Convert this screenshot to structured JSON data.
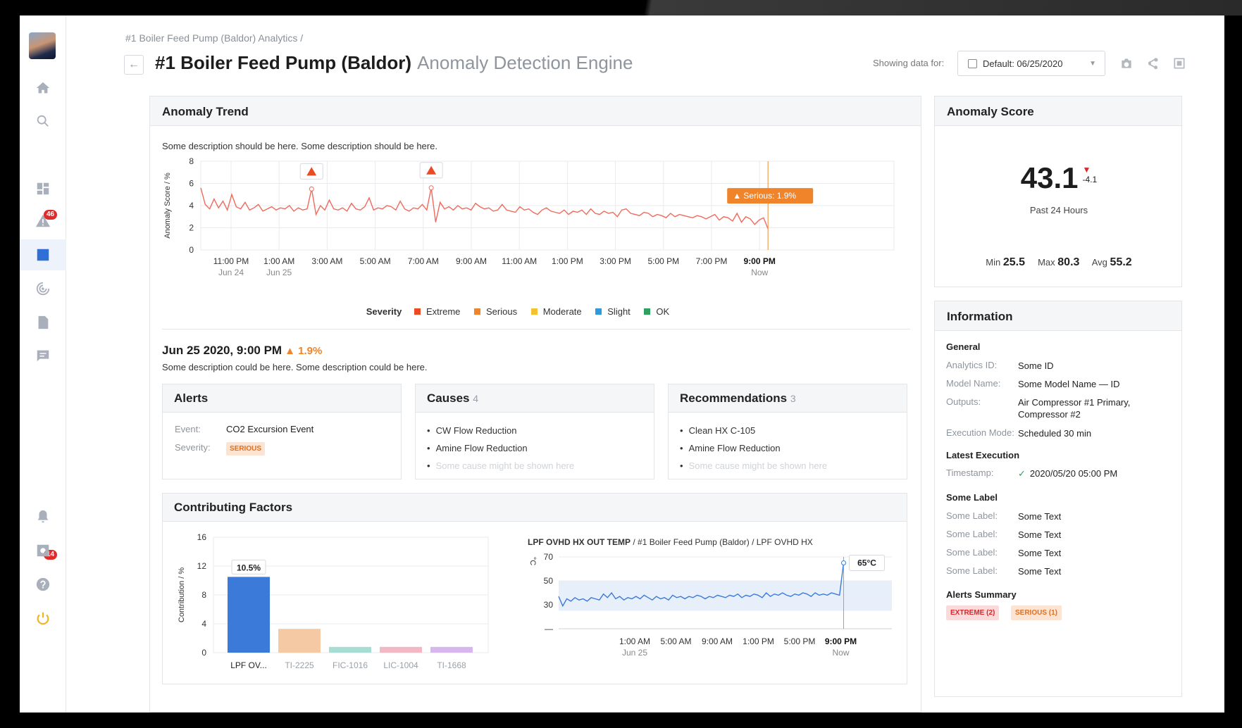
{
  "sidebar": {
    "notif_alerts": "46",
    "notif_bell": "14"
  },
  "breadcrumb": {
    "text": "#1 Boiler Feed Pump (Baldor) Analytics",
    "sep": "/"
  },
  "header": {
    "title": "#1 Boiler Feed Pump (Baldor)",
    "subtitle": "Anomaly Detection Engine",
    "showing_label": "Showing data for:",
    "date_value": "Default: 06/25/2020"
  },
  "trend": {
    "title": "Anomaly Trend",
    "description": "Some description should be here. Some description should be here.",
    "tooltip": "Serious: 1.9%",
    "severity_label": "Severity",
    "legend": [
      {
        "name": "Extreme",
        "color": "#ea4a24"
      },
      {
        "name": "Serious",
        "color": "#f0842b"
      },
      {
        "name": "Moderate",
        "color": "#f2c230"
      },
      {
        "name": "Slight",
        "color": "#2d9bdb"
      },
      {
        "name": "OK",
        "color": "#2fa060"
      }
    ]
  },
  "event": {
    "datetime": "Jun 25 2020, 9:00 PM",
    "pct": "1.9%",
    "description": "Some description could be here. Some description could be here."
  },
  "alerts": {
    "title": "Alerts",
    "event_label": "Event:",
    "event_value": "CO2 Excursion Event",
    "severity_label": "Severity:",
    "severity_value": "SERIOUS"
  },
  "causes": {
    "title": "Causes",
    "count": "4",
    "items": [
      "CW Flow Reduction",
      "Amine Flow Reduction",
      "Some cause might be shown here"
    ]
  },
  "recs": {
    "title": "Recommendations",
    "count": "3",
    "items": [
      "Clean HX C-105",
      "Amine Flow Reduction",
      "Some cause might be shown here"
    ]
  },
  "factors": {
    "title": "Contributing Factors",
    "callout": "10.5%",
    "line_title_bold": "LPF OVHD HX OUT TEMP",
    "line_title_rest": " / #1 Boiler Feed Pump (Baldor) / LPF OVHD HX",
    "line_callout": "65°C",
    "line_ylabel": "°C"
  },
  "score": {
    "title": "Anomaly Score",
    "value": "43.1",
    "delta": "-4.1",
    "period": "Past 24 Hours",
    "min_label": "Min",
    "min": "25.5",
    "max_label": "Max",
    "max": "80.3",
    "avg_label": "Avg",
    "avg": "55.2"
  },
  "info": {
    "title": "Information",
    "general": "General",
    "rows": [
      {
        "k": "Analytics ID:",
        "v": "Some ID"
      },
      {
        "k": "Model Name:",
        "v": "Some Model Name — ID"
      },
      {
        "k": "Outputs:",
        "v": "Air Compressor #1 Primary, Compressor #2"
      },
      {
        "k": "Execution Mode:",
        "v": "Scheduled 30 min"
      }
    ],
    "latest": "Latest Execution",
    "ts_label": "Timestamp:",
    "ts_value": "2020/05/20 05:00 PM",
    "some_label": "Some Label",
    "labels": [
      {
        "k": "Some Label:",
        "v": "Some Text"
      },
      {
        "k": "Some Label:",
        "v": "Some Text"
      },
      {
        "k": "Some Label:",
        "v": "Some Text"
      },
      {
        "k": "Some Label:",
        "v": "Some Text"
      }
    ],
    "summary": "Alerts Summary",
    "pill_extreme": "EXTREME (2)",
    "pill_serious": "SERIOUS (1)"
  },
  "chart_data": [
    {
      "type": "line",
      "title": "Anomaly Trend",
      "ylabel": "Anomaly Score / %",
      "ylim": [
        0,
        8
      ],
      "yticks": [
        0,
        2,
        4,
        6,
        8
      ],
      "x_ticks": [
        {
          "l1": "11:00 PM",
          "l2": "Jun 24"
        },
        {
          "l1": "1:00 AM",
          "l2": "Jun 25"
        },
        {
          "l1": "3:00 AM",
          "l2": ""
        },
        {
          "l1": "5:00 AM",
          "l2": ""
        },
        {
          "l1": "7:00 AM",
          "l2": ""
        },
        {
          "l1": "9:00 AM",
          "l2": ""
        },
        {
          "l1": "11:00 AM",
          "l2": ""
        },
        {
          "l1": "1:00 PM",
          "l2": ""
        },
        {
          "l1": "3:00 PM",
          "l2": ""
        },
        {
          "l1": "5:00 PM",
          "l2": ""
        },
        {
          "l1": "7:00 PM",
          "l2": ""
        },
        {
          "l1": "9:00 PM",
          "l2": "Now"
        }
      ],
      "series": [
        {
          "values": [
            5.6,
            4.1,
            3.7,
            4.6,
            3.8,
            4.4,
            3.6,
            5.0,
            3.9,
            3.7,
            4.3,
            3.6,
            3.8,
            4.1,
            3.5,
            3.7,
            3.9,
            3.6,
            3.8,
            3.7,
            4.0,
            3.5,
            3.8,
            3.6,
            3.7,
            5.5,
            3.2,
            4.0,
            3.6,
            4.5,
            3.7,
            3.6,
            3.8,
            3.5,
            4.2,
            3.7,
            3.6,
            3.9,
            4.7,
            3.6,
            3.8,
            3.7,
            4.0,
            3.9,
            3.6,
            4.4,
            3.7,
            3.5,
            3.8,
            3.7,
            4.1,
            3.6,
            5.6,
            2.5,
            4.3,
            3.7,
            3.9,
            3.6,
            4.0,
            3.7,
            3.8,
            3.6,
            4.2,
            3.9,
            3.7,
            3.8,
            3.5,
            3.6,
            4.1,
            3.6,
            3.5,
            3.4,
            3.9,
            3.6,
            3.7,
            3.4,
            3.2,
            3.6,
            3.8,
            3.5,
            3.4,
            3.3,
            3.6,
            3.2,
            3.5,
            3.4,
            3.6,
            3.2,
            3.7,
            3.3,
            3.2,
            3.5,
            3.3,
            3.4,
            3.0,
            3.6,
            3.7,
            3.3,
            3.2,
            3.1,
            3.4,
            3.3,
            3.0,
            3.2,
            3.1,
            2.9,
            3.3,
            3.0,
            3.2,
            3.1,
            3.0,
            2.9,
            3.1,
            3.0,
            2.8,
            3.0,
            3.2,
            2.7,
            3.0,
            2.9,
            2.6,
            3.3,
            2.5,
            3.0,
            2.8,
            2.3,
            2.7,
            2.9,
            1.9
          ]
        }
      ]
    },
    {
      "type": "bar",
      "title": "Contributing Factors",
      "ylabel": "Contribution / %",
      "ylim": [
        0,
        16
      ],
      "yticks": [
        0,
        4,
        8,
        12,
        16
      ],
      "categories": [
        "LPF OV...",
        "TI-2225",
        "FIC-1016",
        "LIC-1004",
        "TI-1668"
      ],
      "values": [
        10.5,
        3.3,
        0.8,
        0.8,
        0.8
      ],
      "colors": [
        "#3b7ad9",
        "#f6c9a5",
        "#a7ddd2",
        "#f2b8c6",
        "#d7b8ee"
      ]
    },
    {
      "type": "line",
      "title": "LPF OVHD HX OUT TEMP",
      "ylabel": "°C",
      "ylim": [
        10,
        70
      ],
      "yticks": [
        30,
        50,
        70
      ],
      "x_ticks": [
        {
          "l1": "1:00 AM",
          "l2": "Jun 25"
        },
        {
          "l1": "5:00 AM",
          "l2": ""
        },
        {
          "l1": "9:00 AM",
          "l2": ""
        },
        {
          "l1": "1:00 PM",
          "l2": ""
        },
        {
          "l1": "5:00 PM",
          "l2": ""
        },
        {
          "l1": "9:00 PM",
          "l2": "Now"
        }
      ],
      "series": [
        {
          "values": [
            37,
            29,
            35,
            33,
            36,
            34,
            35,
            33,
            36,
            35,
            34,
            39,
            36,
            40,
            35,
            37,
            34,
            36,
            35,
            37,
            35,
            38,
            36,
            34,
            37,
            35,
            36,
            34,
            38,
            36,
            37,
            35,
            37,
            36,
            38,
            37,
            35,
            37,
            36,
            38,
            37,
            36,
            38,
            37,
            39,
            36,
            38,
            37,
            39,
            38,
            36,
            40,
            37,
            39,
            38,
            40,
            38,
            37,
            39,
            38,
            40,
            39,
            37,
            40,
            38,
            39,
            38,
            40,
            39,
            38,
            65
          ]
        }
      ]
    }
  ]
}
